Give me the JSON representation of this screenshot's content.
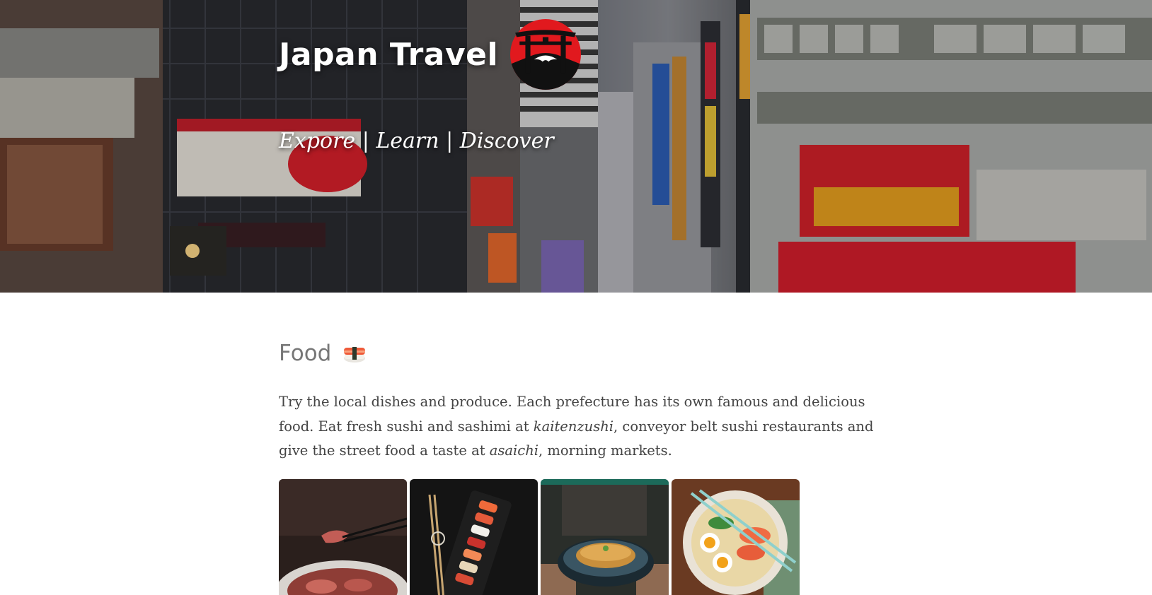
{
  "hero": {
    "title": "Japan Travel",
    "tagline": "Expore | Learn | Discover",
    "logo_icon": "torii-gate-mount-fuji-icon",
    "accent": "#e1191e"
  },
  "food": {
    "heading": "Food",
    "heading_icon": "sushi-icon",
    "text_1": "Try the local dishes and produce. Each prefecture has its own famous and delicious food. Eat fresh sushi and sashimi at ",
    "em_1": "kaitenzushi",
    "text_2": ", conveyor belt sushi restaurants and give the street food a taste at ",
    "em_2": "asaichi",
    "text_3": ", morning markets."
  },
  "gallery": [
    {
      "name": "wagyu-photo"
    },
    {
      "name": "sushi-platter-photo"
    },
    {
      "name": "tonkatsu-photo"
    },
    {
      "name": "ramen-photo"
    }
  ]
}
